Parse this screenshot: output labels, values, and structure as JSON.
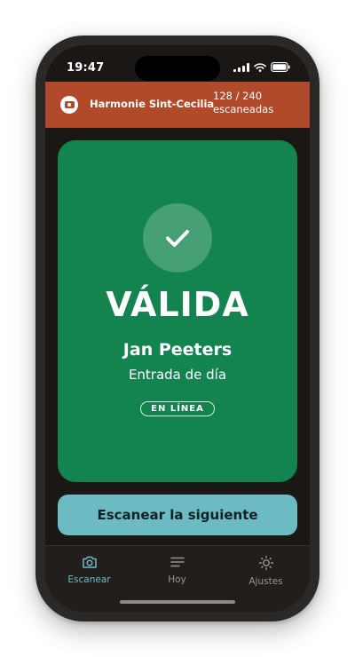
{
  "status_bar": {
    "time": "19:47"
  },
  "header": {
    "org_name": "Harmonie Sint-Cecilia",
    "count_line1": "128 / 240",
    "count_line2": "escaneadas",
    "brand_color": "#b1492b"
  },
  "result": {
    "verdict": "VÁLIDA",
    "holder": "Jan Peeters",
    "ticket_type": "Entrada de día",
    "mode_badge": "EN LÍNEA",
    "color": "#13844f",
    "icon": "check-icon"
  },
  "next_button": {
    "label": "Escanear la siguiente",
    "color": "#6cbac2"
  },
  "tabs": [
    {
      "label": "Escanear",
      "icon": "camera-icon",
      "active": true
    },
    {
      "label": "Hoy",
      "icon": "list-icon",
      "active": false
    },
    {
      "label": "Ajustes",
      "icon": "sun-icon",
      "active": false
    }
  ]
}
